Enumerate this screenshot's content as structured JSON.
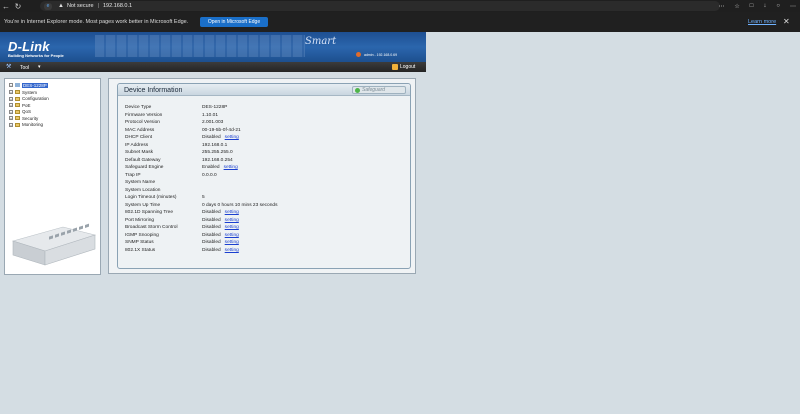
{
  "browser": {
    "security_label": "Not secure",
    "url": "192.168.0.1",
    "ie_message": "You're in Internet Explorer mode. Most pages work better in Microsoft Edge.",
    "open_edge_button": "Open in Microsoft Edge",
    "learn_more": "Learn more"
  },
  "header": {
    "brand": "D-Link",
    "tagline": "Building Networks for People",
    "product": "Smart",
    "user": "admin - 192.168.0.69"
  },
  "toolbar": {
    "tool_label": "Tool",
    "logout_label": "Logout"
  },
  "tree": {
    "root": "DES-1228P",
    "items": [
      "System",
      "Configuration",
      "PoE",
      "QoS",
      "Security",
      "Monitoring"
    ]
  },
  "device_info": {
    "title": "Device Information",
    "safeguard_label": "Safeguard",
    "rows": [
      {
        "key": "Device Type",
        "value": "DES-1228P",
        "link": ""
      },
      {
        "key": "Firmware Version",
        "value": "1.10.01",
        "link": ""
      },
      {
        "key": "Protocol Version",
        "value": "2.001.003",
        "link": ""
      },
      {
        "key": "MAC Address",
        "value": "00-19-5b-0f-4d-21",
        "link": ""
      },
      {
        "key": "DHCP Client",
        "value": "Disabled",
        "link": "setting"
      },
      {
        "key": "IP Address",
        "value": "192.168.0.1",
        "link": ""
      },
      {
        "key": "Subnet Mask",
        "value": "255.255.255.0",
        "link": ""
      },
      {
        "key": "Default Gateway",
        "value": "192.168.0.254",
        "link": ""
      },
      {
        "key": "Safeguard Engine",
        "value": "Enabled",
        "link": "setting"
      },
      {
        "key": "Trap IP",
        "value": "0.0.0.0",
        "link": ""
      },
      {
        "key": "System Name",
        "value": "",
        "link": ""
      },
      {
        "key": "System Location",
        "value": "",
        "link": ""
      },
      {
        "key": "Login Timeout (minutes)",
        "value": "5",
        "link": ""
      },
      {
        "key": "System Up Time",
        "value": "0 days 0 hours 10 mins 23 seconds",
        "link": ""
      },
      {
        "key": "802.1D Spanning Tree",
        "value": "Disabled",
        "link": "setting"
      },
      {
        "key": "Port Mirroring",
        "value": "Disabled",
        "link": "setting"
      },
      {
        "key": "Broadcast Storm Control",
        "value": "Disabled",
        "link": "setting"
      },
      {
        "key": "IGMP Snooping",
        "value": "Disabled",
        "link": "setting"
      },
      {
        "key": "SNMP Status",
        "value": "Disabled",
        "link": "setting"
      },
      {
        "key": "802.1X Status",
        "value": "Disabled",
        "link": "setting"
      }
    ]
  }
}
